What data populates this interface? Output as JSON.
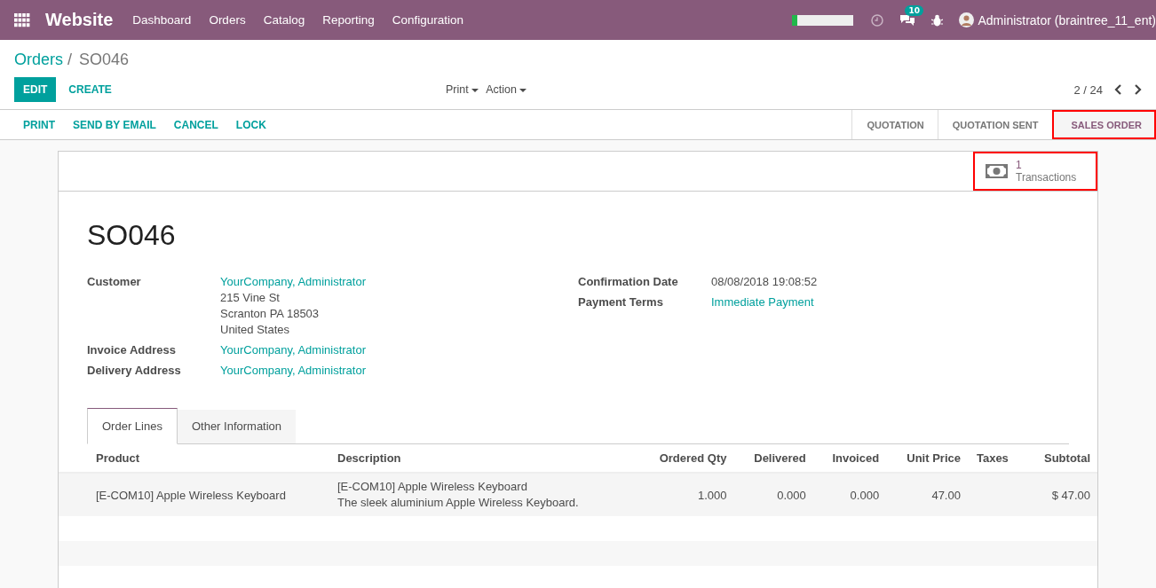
{
  "navbar": {
    "app_name": "Website",
    "menu": [
      "Dashboard",
      "Orders",
      "Catalog",
      "Reporting",
      "Configuration"
    ],
    "progress": {
      "level": 0.08
    },
    "chat_count": "10",
    "user": "Administrator (braintree_11_ent)"
  },
  "breadcrumb": {
    "parent": "Orders",
    "separator": "/",
    "current": "SO046"
  },
  "buttons": [
    "EDIT",
    "CREATE"
  ],
  "dropdowns": [
    "Print",
    "Action"
  ],
  "pager": "2 / 24",
  "actions": [
    "PRINT",
    "SEND BY EMAIL",
    "CANCEL",
    "LOCK"
  ],
  "stages": [
    {
      "label": "QUOTATION",
      "selected": false
    },
    {
      "label": "QUOTATION SENT",
      "selected": false
    },
    {
      "label": "SALES ORDER",
      "selected": true
    }
  ],
  "smart_button": {
    "count": "1",
    "label": "Transactions"
  },
  "title": "SO046",
  "left_fields": [
    {
      "label": "Customer",
      "value": "YourCompany, Administrator",
      "address": [
        "215 Vine St",
        "Scranton PA 18503",
        "United States"
      ]
    },
    {
      "label": "Invoice Address",
      "value": "YourCompany, Administrator"
    },
    {
      "label": "Delivery Address",
      "value": "YourCompany, Administrator"
    }
  ],
  "right_fields": [
    {
      "label": "Confirmation Date",
      "value": "08/08/2018 19:08:52",
      "kind": "text"
    },
    {
      "label": "Payment Terms",
      "value": "Immediate Payment",
      "kind": "link"
    }
  ],
  "tabs": [
    {
      "label": "Order Lines",
      "selected": true
    },
    {
      "label": "Other Information",
      "selected": false
    }
  ],
  "table": {
    "columns": [
      "Product",
      "Description",
      "Ordered Qty",
      "Delivered",
      "Invoiced",
      "Unit Price",
      "Taxes",
      "Subtotal"
    ],
    "rows": [
      {
        "cells": [
          "[E-COM10] Apple Wireless Keyboard",
          [
            "[E-COM10] Apple Wireless Keyboard",
            "The sleek aluminium Apple Wireless Keyboard."
          ],
          "1.000",
          "0.000",
          "0.000",
          "47.00",
          "",
          "$ 47.00"
        ]
      }
    ]
  }
}
